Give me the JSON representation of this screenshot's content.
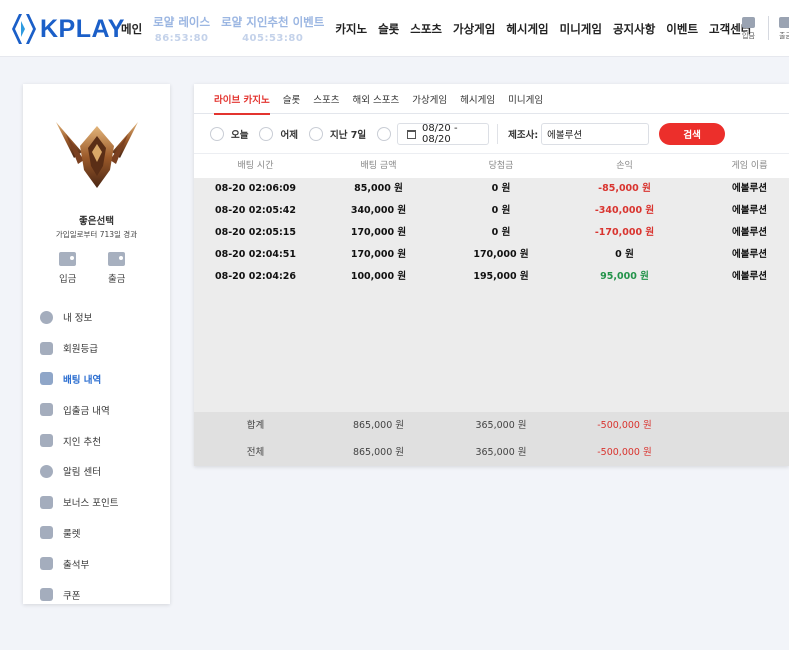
{
  "header": {
    "logo_text": "KPLAY",
    "nav": [
      {
        "label": "메인",
        "highlight": false
      },
      {
        "label": "로얄 레이스",
        "sub": "86:53:80",
        "highlight": true
      },
      {
        "label": "로얄 지인추천 이벤트",
        "sub": "405:53:80",
        "highlight": true
      },
      {
        "label": "카지노",
        "highlight": false
      },
      {
        "label": "슬롯",
        "highlight": false
      },
      {
        "label": "스포츠",
        "highlight": false
      },
      {
        "label": "가상게임",
        "highlight": false
      },
      {
        "label": "헤시게임",
        "highlight": false
      },
      {
        "label": "미니게임",
        "highlight": false
      },
      {
        "label": "공지사항",
        "highlight": false
      },
      {
        "label": "이벤트",
        "highlight": false
      },
      {
        "label": "고객센터",
        "highlight": false
      }
    ],
    "deposit_label": "입금",
    "withdraw_label": "출금"
  },
  "sidebar": {
    "user_name": "좋은선택",
    "member_since": "가입일로부터 713일 경과",
    "deposit_label": "입금",
    "withdraw_label": "출금",
    "menu": [
      {
        "label": "내 정보",
        "icon": "user-icon"
      },
      {
        "label": "회원등급",
        "icon": "grade-icon"
      },
      {
        "label": "배팅 내역",
        "icon": "bet-history-icon",
        "active": true
      },
      {
        "label": "입출금 내역",
        "icon": "wallet-icon"
      },
      {
        "label": "지인 추천",
        "icon": "heart-icon"
      },
      {
        "label": "알림 센터",
        "icon": "chat-icon"
      },
      {
        "label": "보너스 포인트",
        "icon": "bonus-icon"
      },
      {
        "label": "룰렛",
        "icon": "roulette-icon"
      },
      {
        "label": "출석부",
        "icon": "attendance-icon"
      },
      {
        "label": "쿠폰",
        "icon": "coupon-icon"
      }
    ]
  },
  "tabs": [
    "라이브 카지노",
    "슬롯",
    "스포츠",
    "해외 스포츠",
    "가상게임",
    "헤시게임",
    "미니게임"
  ],
  "filters": {
    "today": "오늘",
    "yesterday": "어제",
    "last7": "지난 7일",
    "date_range": "08/20 - 08/20",
    "provider_label": "제조사:",
    "provider_value": "에볼루션",
    "search_label": "검색"
  },
  "table": {
    "headers": [
      "배팅 시간",
      "배팅 금액",
      "당첨금",
      "손익",
      "게임 이름"
    ],
    "rows": [
      {
        "time": "08-20 02:06:09",
        "bet": "85,000 원",
        "win": "0 원",
        "profit": "-85,000 원",
        "game": "에볼루션",
        "sign": "neg"
      },
      {
        "time": "08-20 02:05:42",
        "bet": "340,000 원",
        "win": "0 원",
        "profit": "-340,000 원",
        "game": "에볼루션",
        "sign": "neg"
      },
      {
        "time": "08-20 02:05:15",
        "bet": "170,000 원",
        "win": "0 원",
        "profit": "-170,000 원",
        "game": "에볼루션",
        "sign": "neg"
      },
      {
        "time": "08-20 02:04:51",
        "bet": "170,000 원",
        "win": "170,000 원",
        "profit": "0 원",
        "game": "에볼루션",
        "sign": "zero"
      },
      {
        "time": "08-20 02:04:26",
        "bet": "100,000 원",
        "win": "195,000 원",
        "profit": "95,000 원",
        "game": "에볼루션",
        "sign": "pos"
      }
    ],
    "footer": [
      {
        "label": "합계",
        "bet": "865,000 원",
        "win": "365,000 원",
        "profit": "-500,000 원"
      },
      {
        "label": "전체",
        "bet": "865,000 원",
        "win": "365,000 원",
        "profit": "-500,000 원"
      }
    ]
  },
  "colors": {
    "brand": "#1b5fc8",
    "accent_red": "#ec2f2b",
    "negative": "#d9342f",
    "positive": "#23934a"
  }
}
